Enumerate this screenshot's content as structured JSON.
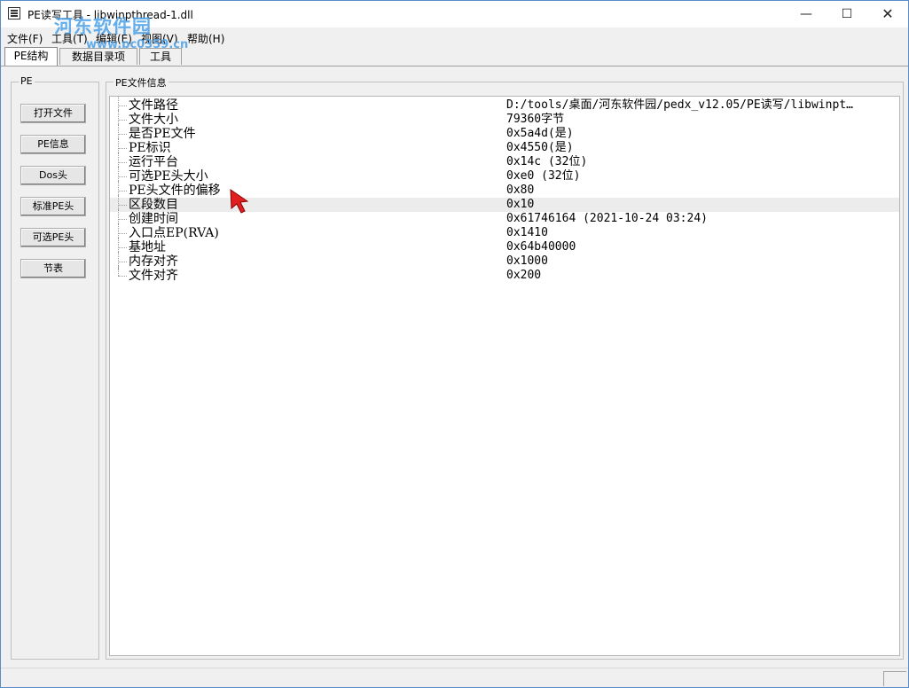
{
  "window": {
    "title": "PE读写工具 - libwinpthread-1.dll",
    "watermark": "河东软件园",
    "watermark_url": "www.pc0359.cn",
    "controls": {
      "minimize": "—",
      "maximize": "☐",
      "close": "✕"
    }
  },
  "menu": [
    {
      "label": "文件(F)"
    },
    {
      "label": "工具(T)"
    },
    {
      "label": "编辑(E)"
    },
    {
      "label": "视图(V)"
    },
    {
      "label": "帮助(H)"
    }
  ],
  "tabs": [
    {
      "label": "PE结构",
      "active": true
    },
    {
      "label": "数据目录项",
      "active": false
    },
    {
      "label": "工具",
      "active": false
    }
  ],
  "left_group": {
    "label": "PE",
    "buttons": [
      {
        "label": "打开文件"
      },
      {
        "label": "PE信息"
      },
      {
        "label": "Dos头"
      },
      {
        "label": "标准PE头"
      },
      {
        "label": "可选PE头"
      },
      {
        "label": "节表"
      }
    ]
  },
  "info_group": {
    "label": "PE文件信息",
    "rows": [
      {
        "name": "文件路径",
        "value": "D:/tools/桌面/河东软件园/pedx_v12.05/PE读写/libwinpt…"
      },
      {
        "name": "文件大小",
        "value": "79360字节"
      },
      {
        "name": "是否PE文件",
        "value": "0x5a4d(是)"
      },
      {
        "name": "PE标识",
        "value": "0x4550(是)"
      },
      {
        "name": "运行平台",
        "value": "0x14c (32位)"
      },
      {
        "name": "可选PE头大小",
        "value": "0xe0 (32位)"
      },
      {
        "name": "PE头文件的偏移",
        "value": "0x80"
      },
      {
        "name": "区段数目",
        "value": "0x10"
      },
      {
        "name": "创建时间",
        "value": "0x61746164 (2021-10-24 03:24)"
      },
      {
        "name": "入口点EP(RVA)",
        "value": "0x1410"
      },
      {
        "name": "基地址",
        "value": "0x64b40000"
      },
      {
        "name": "内存对齐",
        "value": "0x1000"
      },
      {
        "name": "文件对齐",
        "value": "0x200"
      }
    ],
    "highlighted_row": 7
  },
  "colors": {
    "accent": "#4aa0e8",
    "cursor": "#e02020",
    "highlight": "#ececec"
  }
}
